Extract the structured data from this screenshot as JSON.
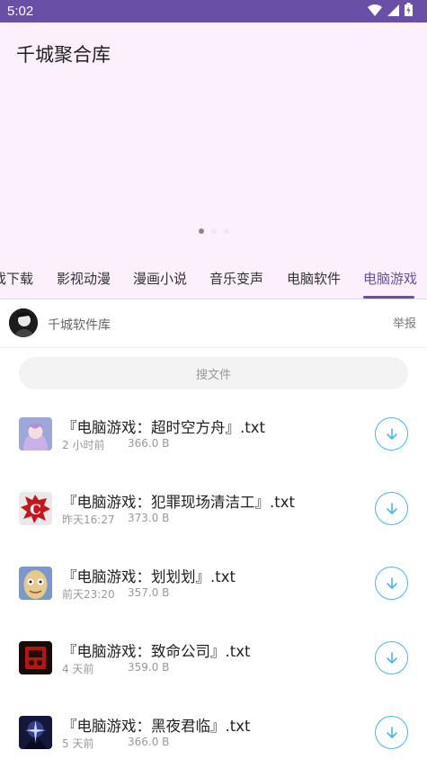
{
  "status_bar": {
    "time": "5:02",
    "icons": [
      "wifi-icon",
      "signal-icon",
      "battery-icon"
    ],
    "color": "#6a4fa6"
  },
  "banner": {
    "title": "千城聚合库",
    "background": "#fbf0fc"
  },
  "tabs": [
    {
      "label": "游戏下载"
    },
    {
      "label": "影视动漫"
    },
    {
      "label": "漫画小说"
    },
    {
      "label": "音乐变声"
    },
    {
      "label": "电脑软件"
    },
    {
      "label": "电脑游戏",
      "active": true
    }
  ],
  "owner": {
    "name": "千城软件库",
    "report_label": "举报"
  },
  "search": {
    "placeholder": "搜文件"
  },
  "files": [
    {
      "name": "『电脑游戏：超时空方舟』.txt",
      "time": "2 小时前",
      "size": "366.0 B",
      "icon": "anime-girl-game-icon"
    },
    {
      "name": "『电脑游戏：犯罪现场清洁工』.txt",
      "time": "昨天16:27",
      "size": "373.0 B",
      "icon": "crime-scene-cleaner-game-icon"
    },
    {
      "name": "『电脑游戏：划划划』.txt",
      "time": "前天23:20",
      "size": "357.0 B",
      "icon": "bald-face-game-icon"
    },
    {
      "name": "『电脑游戏：致命公司』.txt",
      "time": "4 天前",
      "size": "359.0 B",
      "icon": "lethal-company-game-icon"
    },
    {
      "name": "『电脑游戏：黑夜君临』.txt",
      "time": "5 天前",
      "size": "366.0 B",
      "icon": "nightreign-game-icon"
    }
  ],
  "accent_color": "#6a4fa6",
  "download_color": "#49b7e8"
}
